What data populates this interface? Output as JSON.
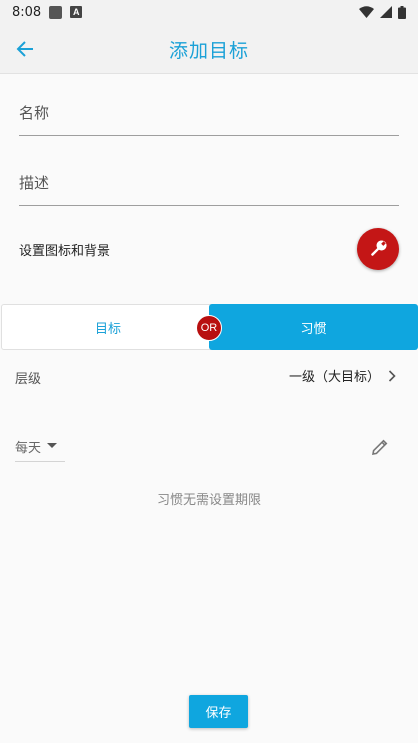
{
  "status_bar": {
    "time": "8:08"
  },
  "app_bar": {
    "title": "添加目标"
  },
  "form": {
    "name_placeholder": "名称",
    "description_placeholder": "描述",
    "icon_bg_label": "设置图标和背景"
  },
  "toggle": {
    "goal_label": "目标",
    "or_label": "OR",
    "habit_label": "习惯",
    "selected": "习惯"
  },
  "level": {
    "label": "层级",
    "value": "一级（大目标）"
  },
  "frequency": {
    "selected": "每天"
  },
  "habit_note": "习惯无需设置期限",
  "save_label": "保存",
  "colors": {
    "accent": "#0fa6df",
    "title": "#1ba1d7",
    "icon_button_bg": "#c41616",
    "or_badge": "#b80f0f"
  },
  "icons": {
    "back": "arrow-left-icon",
    "icon_button": "wrench-icon",
    "level_more": "chevron-right-icon",
    "frequency_dropdown": "caret-down-icon",
    "edit": "pencil-icon",
    "status": [
      "image-icon",
      "text-icon",
      "wifi-icon",
      "signal-icon",
      "battery-icon"
    ]
  }
}
